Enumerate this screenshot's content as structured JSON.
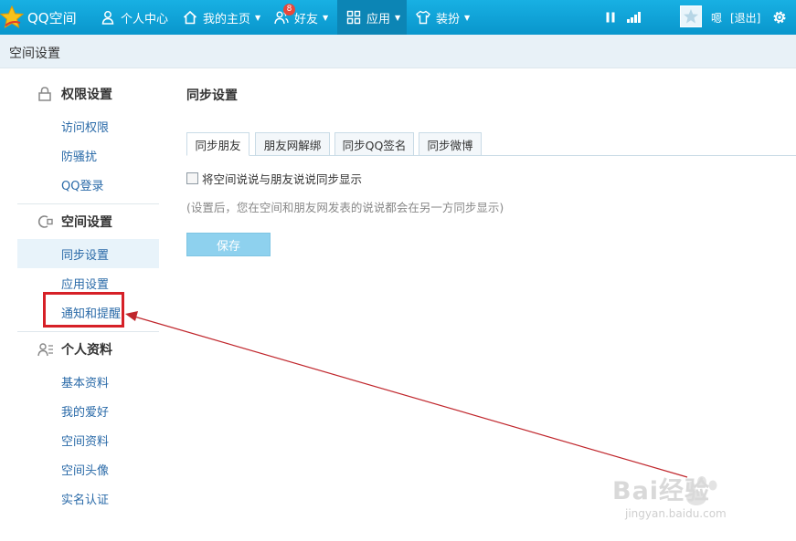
{
  "topbar": {
    "logo_text": "QQ空间",
    "nav": [
      {
        "label": "个人中心"
      },
      {
        "label": "我的主页"
      },
      {
        "label": "好友",
        "badge": "8"
      },
      {
        "label": "应用"
      },
      {
        "label": "装扮"
      }
    ],
    "username": "嗯",
    "logout": "[退出]"
  },
  "titlebar": {
    "title": "空间设置"
  },
  "sidebar": {
    "groups": [
      {
        "title": "权限设置",
        "icon": "lock-icon",
        "items": [
          "访问权限",
          "防骚扰",
          "QQ登录"
        ]
      },
      {
        "title": "空间设置",
        "icon": "settings-plug-icon",
        "items": [
          "同步设置",
          "应用设置",
          "通知和提醒"
        ]
      },
      {
        "title": "个人资料",
        "icon": "profile-icon",
        "items": [
          "基本资料",
          "我的爱好",
          "空间资料",
          "空间头像",
          "实名认证"
        ]
      }
    ],
    "active_item": "同步设置"
  },
  "main": {
    "title": "同步设置",
    "tabs": [
      "同步朋友",
      "朋友网解绑",
      "同步QQ签名",
      "同步微博"
    ],
    "checkbox_label": "将空间说说与朋友说说同步显示",
    "hint": "(设置后，您在空间和朋友网发表的说说都会在另一方同步显示)",
    "save_label": "保存"
  },
  "watermark": {
    "brand": "Bai经验",
    "url": "jingyan.baidu.com"
  },
  "colors": {
    "topbar": "#0aa0d4",
    "link": "#2a6aa8",
    "highlight": "#d62027",
    "save": "#8ed1ee"
  }
}
